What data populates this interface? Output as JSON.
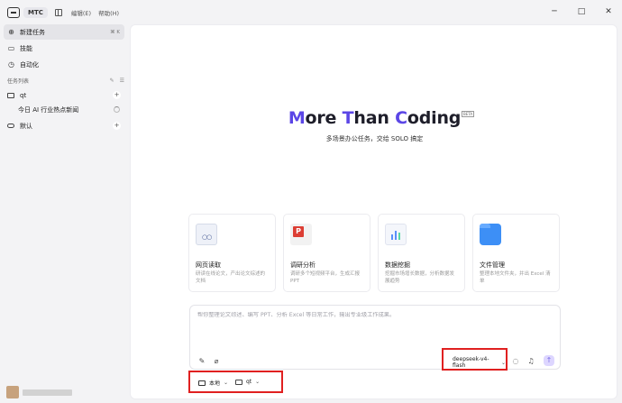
{
  "titlebar": {
    "app_tab": "MTC",
    "menu": [
      "编辑(E)",
      "帮助(H)"
    ],
    "window_controls": [
      "─",
      "□",
      "✕"
    ]
  },
  "sidebar": {
    "items": [
      {
        "label": "新建任务",
        "shortcut": "⌘ K",
        "icon": "chat-plus-icon",
        "active": true
      },
      {
        "label": "技能",
        "icon": "book-icon"
      },
      {
        "label": "自动化",
        "icon": "clock-icon"
      }
    ],
    "section_title": "任务列表",
    "section_tools": [
      "✎",
      "☰"
    ],
    "tasks": [
      {
        "label": "qt",
        "icon": "folder-icon",
        "action": "+"
      },
      {
        "label": "今日 AI 行业热点新闻",
        "status": "running"
      },
      {
        "label": "默认",
        "icon": "cloud-icon",
        "action": "+"
      }
    ]
  },
  "hero": {
    "title_parts": [
      "M",
      "ore ",
      "T",
      "han ",
      "C",
      "oding"
    ],
    "beta": "BETA",
    "subtitle": "多场景办公任务，交给 SOLO 搞定"
  },
  "cards": [
    {
      "title": "网页读取",
      "desc": "研读在线论文，产出论文综述的文档",
      "icon": "web-reader-icon"
    },
    {
      "title": "调研分析",
      "desc": "调研多个短视频平台，生成汇报 PPT",
      "icon": "ppt-icon"
    },
    {
      "title": "数据挖掘",
      "desc": "挖掘市场增长数据，分析数据发展趋势",
      "icon": "chart-icon"
    },
    {
      "title": "文件管理",
      "desc": "整理本地文件夹，并出 Excel 清单",
      "icon": "folder-blue-icon"
    }
  ],
  "composer": {
    "placeholder": "帮你整理论文综述、编写 PPT、分析 Excel 等日常工作，输出专业级工作成果。",
    "model": "deepseek-v4-flash",
    "send": "↑"
  },
  "bottom": {
    "env": "本地",
    "workspace": "qt"
  },
  "colors": {
    "accent": "#5b46e6",
    "highlight_box": "#e02020"
  }
}
